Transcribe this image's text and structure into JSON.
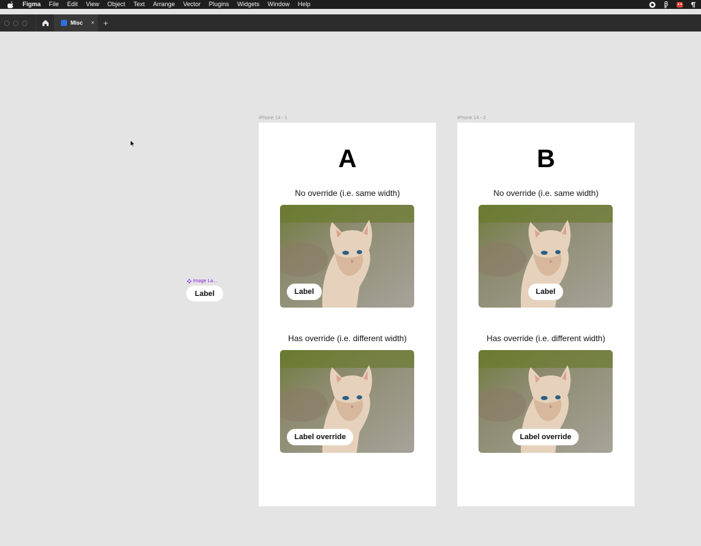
{
  "menubar": {
    "app_name": "Figma",
    "items": [
      "File",
      "Edit",
      "View",
      "Object",
      "Text",
      "Arrange",
      "Vector",
      "Plugins",
      "Widgets",
      "Window",
      "Help"
    ]
  },
  "tabbar": {
    "tab_title": "Misc",
    "close_glyph": "×",
    "add_glyph": "+"
  },
  "canvas": {
    "component": {
      "tag": "Image La...",
      "label": "Label"
    },
    "frames": [
      {
        "name": "iPhone 14 - 1",
        "letter": "A",
        "caption_top": "No override (i.e. same width)",
        "label_top": "Label",
        "caption_bottom": "Has override (i.e. different width)",
        "label_bottom": "Label override"
      },
      {
        "name": "iPhone 14 - 2",
        "letter": "B",
        "caption_top": "No override (i.e. same width)",
        "label_top": "Label",
        "caption_bottom": "Has override (i.e. different width)",
        "label_bottom": "Label override"
      }
    ]
  },
  "colors": {
    "canvas_bg": "#e4e4e4",
    "menubar_bg": "#1e1e1e",
    "tabbar_bg": "#2c2c2c",
    "component_purple": "#8a24e0"
  }
}
